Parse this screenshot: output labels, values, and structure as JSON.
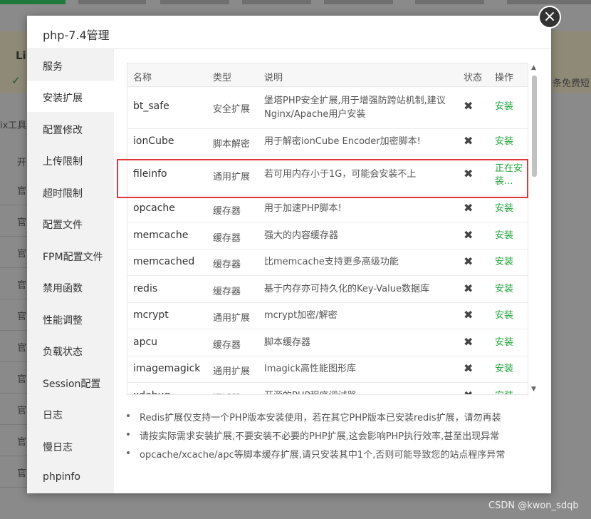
{
  "background": {
    "banner_title": "Lin",
    "banner_check": "✓",
    "banner_right_text": "条免费短",
    "left_text": "ix工具箱",
    "column_head": "开",
    "row_label": "官",
    "watermark": "CSDN @kwon_sdqb"
  },
  "modal": {
    "title": "php-7.4管理",
    "close_symbol": "×"
  },
  "sidebar": {
    "items": [
      {
        "label": "服务"
      },
      {
        "label": "安装扩展"
      },
      {
        "label": "配置修改"
      },
      {
        "label": "上传限制"
      },
      {
        "label": "超时限制"
      },
      {
        "label": "配置文件"
      },
      {
        "label": "FPM配置文件"
      },
      {
        "label": "禁用函数"
      },
      {
        "label": "性能调整"
      },
      {
        "label": "负载状态"
      },
      {
        "label": "Session配置"
      },
      {
        "label": "日志"
      },
      {
        "label": "慢日志"
      },
      {
        "label": "phpinfo"
      }
    ]
  },
  "table": {
    "headers": {
      "name": "名称",
      "type": "类型",
      "desc": "说明",
      "status": "状态",
      "op": "操作"
    },
    "rows": [
      {
        "name": "bt_safe",
        "type": "安全扩展",
        "desc": "堡塔PHP安全扩展,用于增强防跨站机制,建议Nginx/Apache用户安装",
        "status": "✖",
        "op": "安装"
      },
      {
        "name": "ionCube",
        "type": "脚本解密",
        "desc": "用于解密ionCube Encoder加密脚本!",
        "status": "✖",
        "op": "安装"
      },
      {
        "name": "fileinfo",
        "type": "通用扩展",
        "desc": "若可用内存小于1G，可能会安装不上",
        "status": "✖",
        "op": "正在安装..."
      },
      {
        "name": "opcache",
        "type": "缓存器",
        "desc": "用于加速PHP脚本!",
        "status": "✖",
        "op": "安装"
      },
      {
        "name": "memcache",
        "type": "缓存器",
        "desc": "强大的内容缓存器",
        "status": "✖",
        "op": "安装"
      },
      {
        "name": "memcached",
        "type": "缓存器",
        "desc": "比memcache支持更多高级功能",
        "status": "✖",
        "op": "安装"
      },
      {
        "name": "redis",
        "type": "缓存器",
        "desc": "基于内存亦可持久化的Key-Value数据库",
        "status": "✖",
        "op": "安装"
      },
      {
        "name": "mcrypt",
        "type": "通用扩展",
        "desc": "mcrypt加密/解密",
        "status": "✖",
        "op": "安装"
      },
      {
        "name": "apcu",
        "type": "缓存器",
        "desc": "脚本缓存器",
        "status": "✖",
        "op": "安装"
      },
      {
        "name": "imagemagick",
        "type": "通用扩展",
        "desc": "Imagick高性能图形库",
        "status": "✖",
        "op": "安装"
      },
      {
        "name": "xdebug",
        "type": "调试器",
        "desc": "开源的PHP程序调试器",
        "status": "✖",
        "op": "安装"
      }
    ]
  },
  "notes": [
    "Redis扩展仅支持一个PHP版本安装使用，若在其它PHP版本已安装redis扩展，请勿再装",
    "请按实际需求安装扩展,不要安装不必要的PHP扩展,这会影响PHP执行效率,甚至出现异常",
    "opcache/xcache/apc等脚本缓存扩展,请只安装其中1个,否则可能导致您的站点程序异常"
  ],
  "colors": {
    "accent_green": "#20a53a",
    "highlight_red": "#e0363a"
  }
}
